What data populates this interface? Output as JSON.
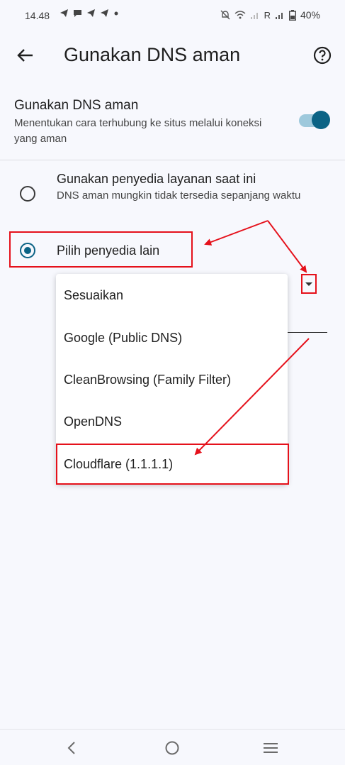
{
  "status_bar": {
    "time": "14.48",
    "battery": "40%",
    "carrier_indicator": "R"
  },
  "header": {
    "title": "Gunakan DNS aman"
  },
  "secure_dns": {
    "title": "Gunakan DNS aman",
    "description": "Menentukan cara terhubung ke situs melalui koneksi yang aman",
    "enabled": true
  },
  "options": [
    {
      "title": "Gunakan penyedia layanan saat ini",
      "description": "DNS aman mungkin tidak tersedia sepanjang waktu",
      "selected": false
    },
    {
      "title": "Pilih penyedia lain",
      "selected": true
    }
  ],
  "provider_menu": {
    "items": [
      "Sesuaikan",
      "Google (Public DNS)",
      "CleanBrowsing (Family Filter)",
      "OpenDNS",
      "Cloudflare (1.1.1.1)"
    ]
  },
  "colors": {
    "accent": "#0b6385",
    "annotation_red": "#e5111b",
    "toggle_track": "#9ec9dc",
    "background": "#f7f8fd"
  },
  "icons": {
    "back": "arrow-left-icon",
    "help": "help-circle-icon",
    "dropdown": "caret-down-icon",
    "nav_back": "chevron-left-icon",
    "nav_home": "circle-home-icon",
    "nav_recents": "menu-lines-icon"
  }
}
